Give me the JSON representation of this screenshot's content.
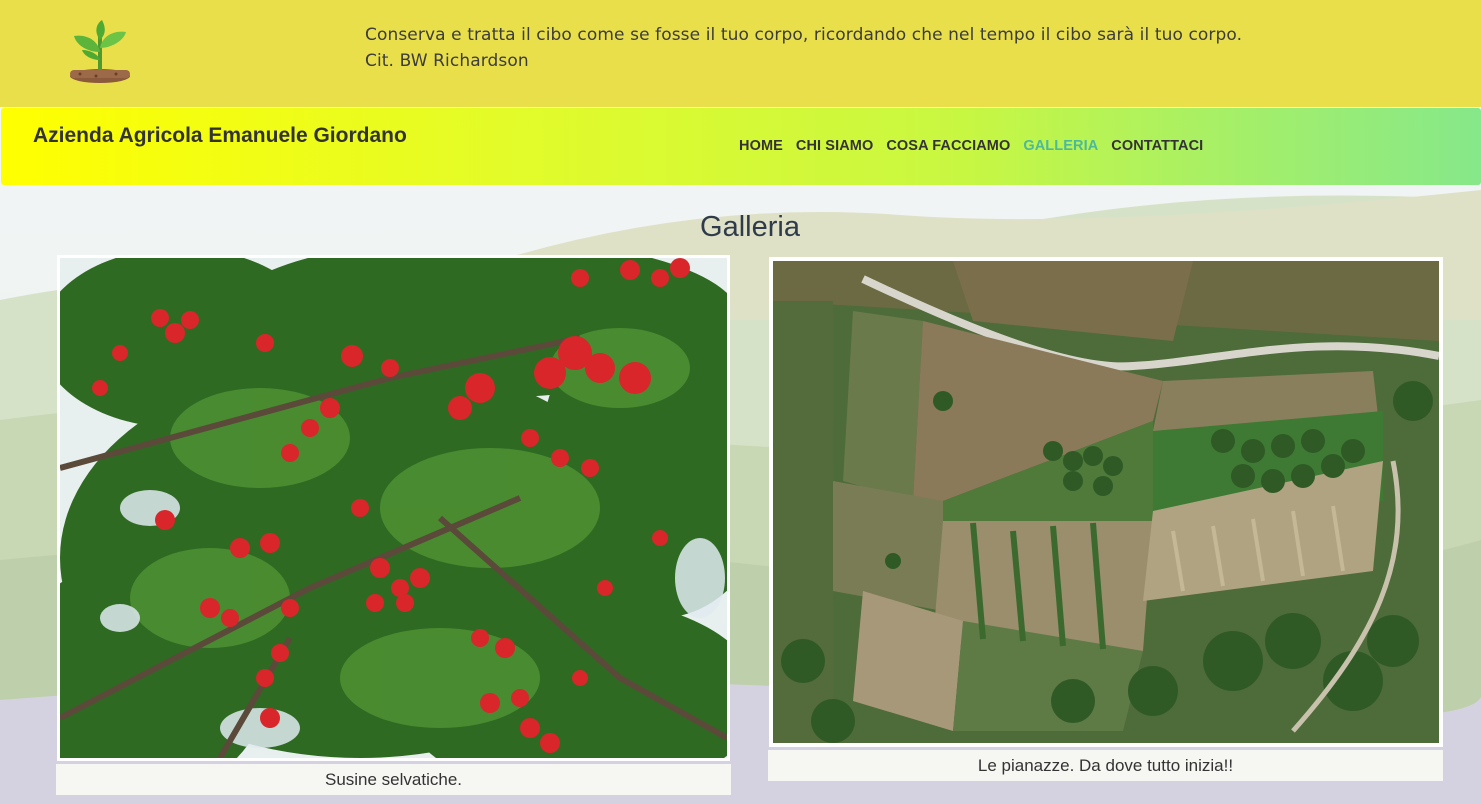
{
  "header": {
    "logo_icon": "sprout-icon",
    "quote_line1": "Conserva e tratta il cibo come se fosse il tuo corpo, ricordando che nel tempo il cibo sarà il tuo corpo.",
    "quote_line2": "Cit. BW Richardson"
  },
  "navbar": {
    "brand": "Azienda Agricola Emanuele Giordano",
    "items": [
      {
        "label": "HOME"
      },
      {
        "label": "CHI SIAMO"
      },
      {
        "label": "COSA FACCIAMO"
      },
      {
        "label": "GALLERIA",
        "active": true
      },
      {
        "label": "CONTATTACI"
      }
    ],
    "active_color": "#4db99b"
  },
  "main": {
    "title": "Galleria",
    "gallery": [
      {
        "caption": "Susine selvatiche."
      },
      {
        "caption": "Le pianazze. Da dove tutto inizia!!"
      }
    ]
  },
  "colors": {
    "topbar": "#e9df4b",
    "navbar_start": "#ffff00",
    "navbar_end": "#86e88a"
  }
}
